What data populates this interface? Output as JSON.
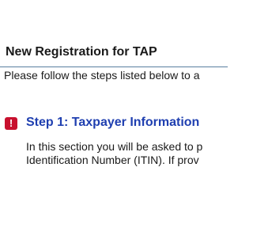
{
  "header": {
    "title": "New Registration for TAP",
    "intro": "Please follow the steps listed below to a"
  },
  "steps": [
    {
      "icon": "alert-icon",
      "icon_glyph": "!",
      "icon_color": "#c8102e",
      "title": "Step 1: Taxpayer Information",
      "title_color": "#1f3fb0",
      "description_lines": [
        "In this section you will be asked to p",
        "Identification Number (ITIN). If prov"
      ]
    }
  ]
}
